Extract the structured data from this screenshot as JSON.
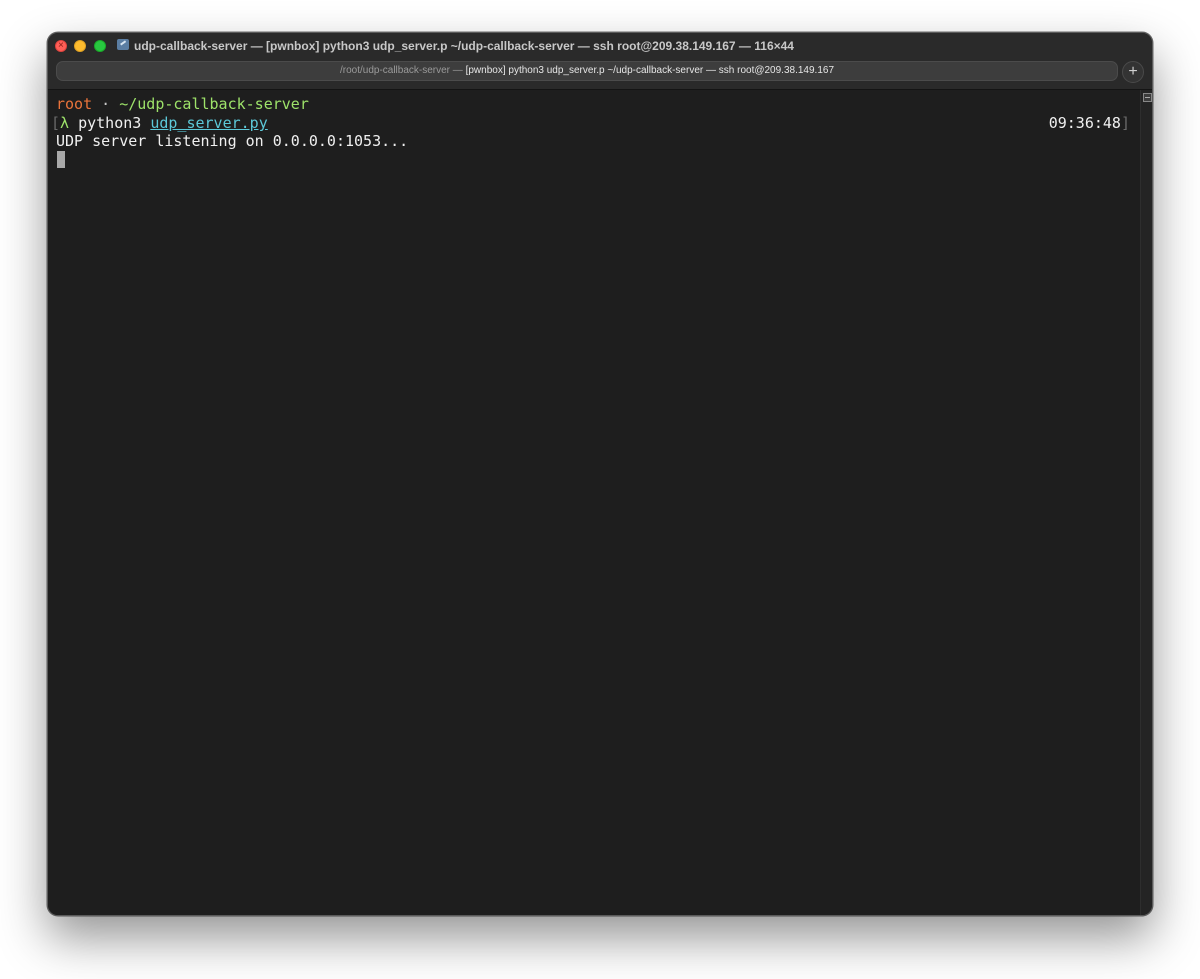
{
  "window": {
    "title": "udp-callback-server — [pwnbox] python3 udp_server.p ~/udp-callback-server — ssh root@209.38.149.167 — 116×44",
    "proxy_icon": "folder-icon"
  },
  "tab": {
    "title_dim": "/root/udp-callback-server — ",
    "title_bright": "[pwnbox] python3 udp_server.p ~/udp-callback-server — ssh root@209.38.149.167",
    "new_tab_label": "+"
  },
  "terminal": {
    "prompt": {
      "user": "root",
      "separator": " · ",
      "path": "~/udp-callback-server"
    },
    "command": {
      "open_bracket": "[",
      "lambda": "λ",
      "program": " python3 ",
      "file": "udp_server.py",
      "time": "09:36:48",
      "close_bracket": "]"
    },
    "output": "UDP server listening on 0.0.0.0:1053..."
  }
}
